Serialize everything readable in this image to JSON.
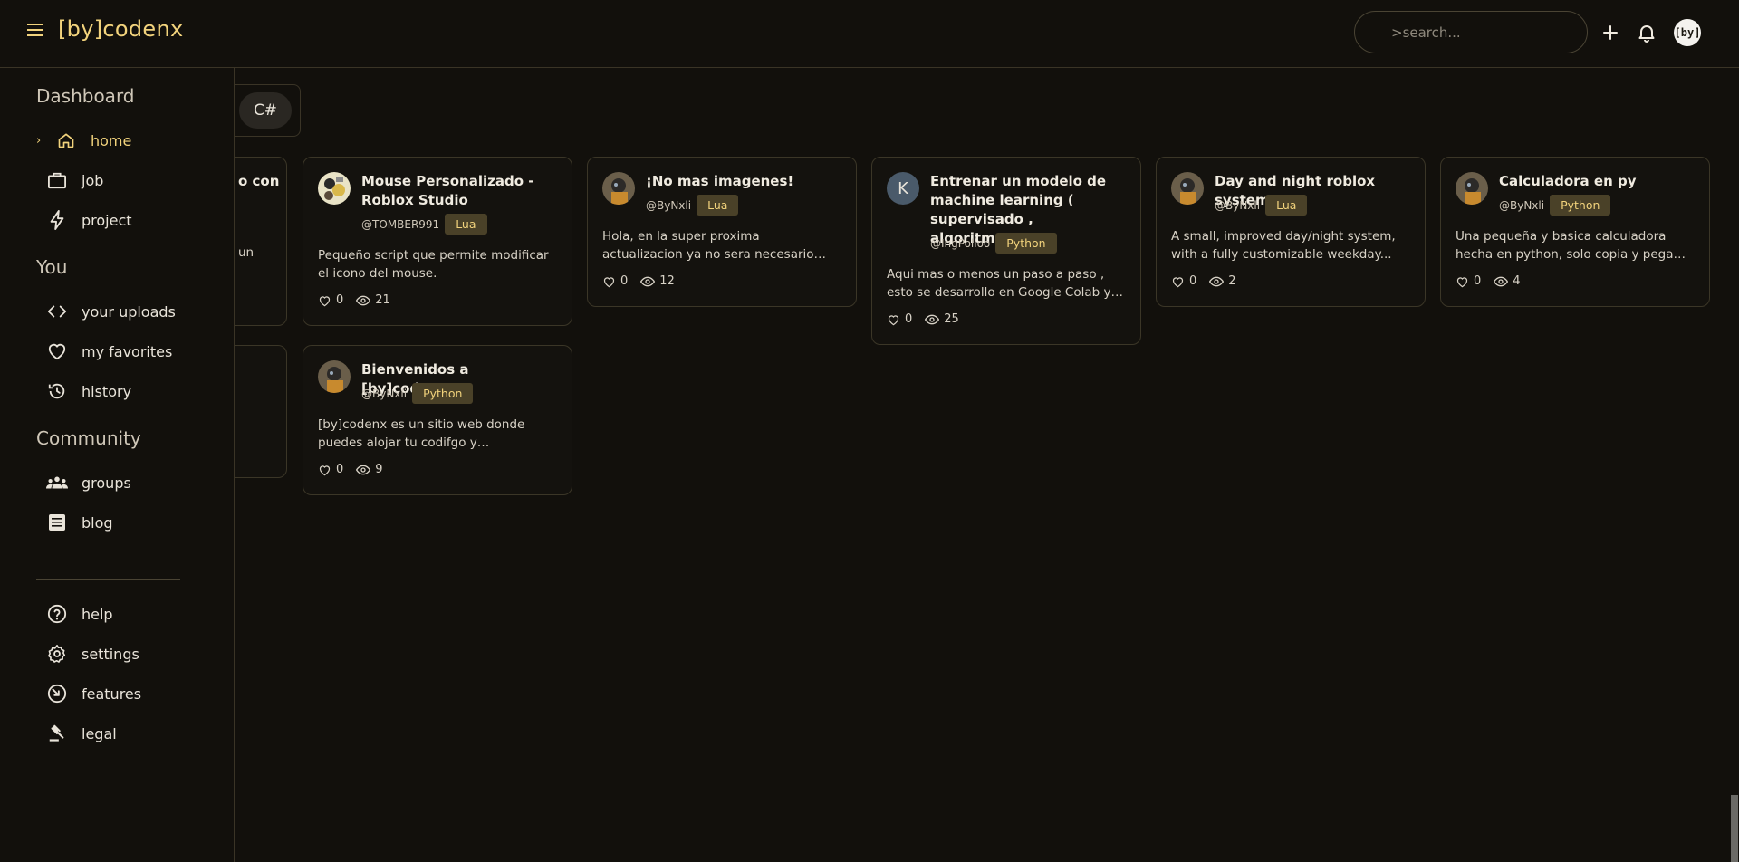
{
  "header": {
    "logo": "[by]codenx",
    "search_placeholder": ">search...",
    "avatar_text": "[by]"
  },
  "sidebar": {
    "sections": {
      "dashboard": "Dashboard",
      "you": "You",
      "community": "Community"
    },
    "items": {
      "home": "home",
      "job": "job",
      "project": "project",
      "uploads": "your uploads",
      "favorites": "my favorites",
      "history": "history",
      "groups": "groups",
      "blog": "blog",
      "help": "help",
      "settings": "settings",
      "features": "features",
      "legal": "legal"
    }
  },
  "filters": {
    "chip": "C#"
  },
  "partial_cards": {
    "card1_title_fragment": "o con",
    "card1_desc_fragment": "un"
  },
  "cards": [
    {
      "title": "Mouse Personalizado - Roblox Studio",
      "user": "@TOMBER991",
      "tag": "Lua",
      "desc": "Pequeño script que permite modificar el icono del mouse.",
      "likes": "0",
      "views": "21"
    },
    {
      "title": "¡No mas imagenes!",
      "user": "@ByNxli",
      "tag": "Lua",
      "desc": "Hola, en la super proxima actualizacion ya no sera necesario subir imagenes...",
      "likes": "0",
      "views": "12"
    },
    {
      "title": "Entrenar un modelo de machine learning ( supervisado , algoritmo...",
      "user": "@IngPolloo",
      "tag": "Python",
      "desc": "Aqui mas o menos un paso a paso , esto se desarrollo en Google Colab ya que...",
      "likes": "0",
      "views": "25",
      "avatar_letter": "K"
    },
    {
      "title": "Day and night roblox system",
      "user": "@ByNxli",
      "tag": "Lua",
      "desc": "A small, improved day/night system, with a fully customizable weekday...",
      "likes": "0",
      "views": "2"
    },
    {
      "title": "Calculadora en py",
      "user": "@ByNxli",
      "tag": "Python",
      "desc": "Una pequeña y basica calculadora hecha en python, solo copia y pega en...",
      "likes": "0",
      "views": "4"
    },
    {
      "title": "Bienvenidos a [by]codenx",
      "user": "@ByNxli",
      "tag": "Python",
      "desc": "[by]codenx es un sitio web donde puedes alojar tu codifgo y compartilo...",
      "likes": "0",
      "views": "9"
    }
  ],
  "colors": {
    "background": "#12100c",
    "accent": "#f2d37c",
    "tag_bg": "#4a4128",
    "border": "#3b3627"
  }
}
